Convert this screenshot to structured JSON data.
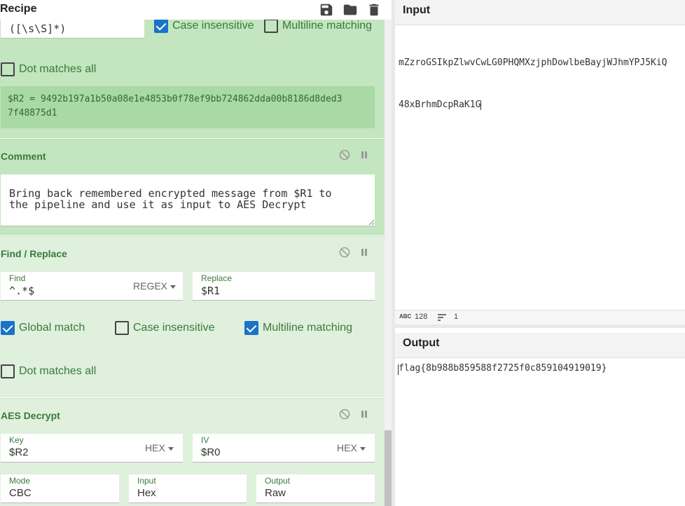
{
  "recipe": {
    "title": "Recipe",
    "header_icons": [
      "save-icon",
      "folder-icon",
      "trash-icon"
    ],
    "regex_op_partial": {
      "regex_value": "([\\s\\S]*)",
      "case_insensitive_label": "Case insensitive",
      "case_insensitive": true,
      "multiline_label": "Multiline matching",
      "multiline": false,
      "dot_all_label": "Dot matches all",
      "dot_all": false,
      "output_line1": "$R2 = 9492b197a1b50a08e1e4853b0f78ef9bb724862dda00b8186d8ded3",
      "output_line2": "7f48875d1"
    },
    "comment_op": {
      "title": "Comment",
      "line1": "Bring back remembered encrypted message from $R1 to",
      "line2": "the pipeline and use it as input to AES Decrypt"
    },
    "find_replace_op": {
      "title": "Find / Replace",
      "find_label": "Find",
      "find_value": "^.*$",
      "find_type": "REGEX",
      "replace_label": "Replace",
      "replace_value": "$R1",
      "global_label": "Global match",
      "global": true,
      "case_insensitive_label": "Case insensitive",
      "case_insensitive": false,
      "multiline_label": "Multiline matching",
      "multiline": true,
      "dot_all_label": "Dot matches all",
      "dot_all": false
    },
    "aes_op": {
      "title": "AES Decrypt",
      "key_label": "Key",
      "key_value": "$R2",
      "key_type": "HEX",
      "iv_label": "IV",
      "iv_value": "$R0",
      "iv_type": "HEX",
      "mode_label": "Mode",
      "mode_value": "CBC",
      "input_label": "Input",
      "input_value": "Hex",
      "output_label": "Output",
      "output_value": "Raw"
    }
  },
  "input": {
    "title": "Input",
    "line1": "mZzroGSIkpZlwvCwLG0PHQMXzjphDowlbeBayjWJhmYPJ5KiQ",
    "line2": "48xBrhmDcpRaK1G",
    "length": "128",
    "lines": "1"
  },
  "output": {
    "title": "Output",
    "text": "flag{8b988b859588f2725f0c859104919019}"
  },
  "colors": {
    "accent": "#1a73c8",
    "op_green": "#dff0dd",
    "op_green_dark": "#c3e5c0",
    "label_green": "#3a7a3a"
  }
}
